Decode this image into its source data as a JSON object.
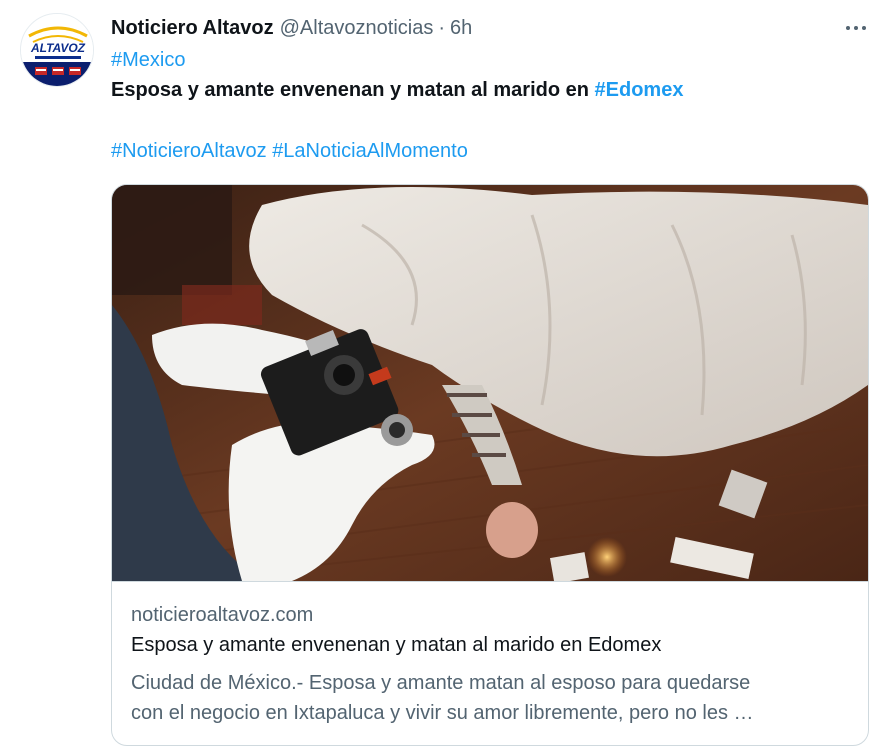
{
  "author": {
    "name": "Noticiero Altavoz",
    "handle": "@Altavoznoticias",
    "separator": "·",
    "time": "6h",
    "avatar_text": "ALTAVOZ",
    "avatar_icon": "altavoz-logo"
  },
  "tweet": {
    "hashtag_mexico": "#Mexico",
    "headline_text": "Esposa y amante envenenan y matan al marido en ",
    "hashtag_edomex": "#Edomex",
    "hashtag_noticiero": "#NoticieroAltavoz",
    "hashtag_lanoticia": "#LaNoticiaAlMomento"
  },
  "card": {
    "domain": "noticieroaltavoz.com",
    "title": "Esposa y amante envenenan y matan al marido en Edomex",
    "description_line1": "Ciudad de México.- Esposa y amante matan al esposo para quedarse",
    "description_line2": "con el negocio en Ixtapaluca y vivir su amor libremente, pero no les …",
    "image_icon": "crime-scene-photo"
  },
  "colors": {
    "link": "#1d9bf0",
    "secondary_text": "#536471",
    "primary_text": "#0f1419",
    "border": "#cfd9de"
  }
}
